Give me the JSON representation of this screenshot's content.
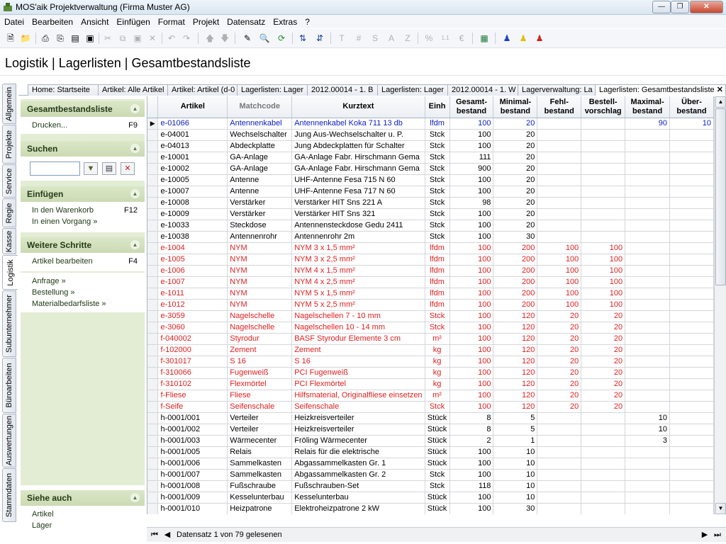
{
  "window": {
    "title": "MOS'aik Projektverwaltung (Firma Muster AG)"
  },
  "menu": [
    "Datei",
    "Bearbeiten",
    "Ansicht",
    "Einfügen",
    "Format",
    "Projekt",
    "Datensatz",
    "Extras",
    "?"
  ],
  "page_title": "Logistik | Lagerlisten | Gesamtbestandsliste",
  "vertical_tabs": [
    "Allgemein",
    "Projekte",
    "Service",
    "Regie",
    "Kasse",
    "Logistik",
    "Subunternehmer",
    "Büroarbeiten",
    "Auswertungen",
    "Stammdaten"
  ],
  "doc_tabs": [
    "Home: Startseite",
    "Artikel: Alle Artikel",
    "Artikel: Artikel (d-0",
    "Lagerlisten: Lager",
    "2012.00014 - 1. B",
    "Lagerlisten: Lager",
    "2012.00014 - 1. W",
    "Lagerverwaltung: La",
    "Lagerlisten: Gesamtbestandsliste"
  ],
  "sidebar": {
    "gesamt": {
      "title": "Gesamtbestandsliste",
      "print_label": "Drucken...",
      "print_key": "F9"
    },
    "suchen": {
      "title": "Suchen",
      "search_value": ""
    },
    "einfuegen": {
      "title": "Einfügen",
      "cart_label": "In den Warenkorb",
      "cart_key": "F12",
      "process_label": "In einen Vorgang »"
    },
    "weitere": {
      "title": "Weitere Schritte",
      "edit_label": "Artikel bearbeiten",
      "edit_key": "F4",
      "anfrage": "Anfrage »",
      "bestellung": "Bestellung »",
      "material": "Materialbedarfsliste »"
    },
    "siehe": {
      "title": "Siehe auch",
      "artikel": "Artikel",
      "lager": "Läger"
    }
  },
  "table": {
    "columns": [
      "Artikel",
      "Matchcode",
      "Kurztext",
      "Einh",
      "Gesamt-\nbestand",
      "Minimal-\nbestand",
      "Fehl-\nbestand",
      "Bestell-\nvorschlag",
      "Maximal-\nbestand",
      "Über-\nbestand"
    ],
    "rows": [
      {
        "c": [
          "e-01066",
          "Antennenkabel",
          "Antennenkabel Koka 711 13 db",
          "lfdm",
          "100",
          "20",
          "",
          "",
          "90",
          "10"
        ],
        "color": "blue",
        "current": true
      },
      {
        "c": [
          "e-04001",
          "Wechselschalter",
          "Jung Aus-Wechselschalter u. P.",
          "Stck",
          "100",
          "20",
          "",
          "",
          "",
          ""
        ]
      },
      {
        "c": [
          "e-04013",
          "Abdeckplatte",
          "Jung Abdeckplatten für Schalter",
          "Stck",
          "100",
          "20",
          "",
          "",
          "",
          ""
        ]
      },
      {
        "c": [
          "e-10001",
          "GA-Anlage",
          "GA-Anlage Fabr. Hirschmann Gema",
          "Stck",
          "111",
          "20",
          "",
          "",
          "",
          ""
        ]
      },
      {
        "c": [
          "e-10002",
          "GA-Anlage",
          "GA-Anlage Fabr. Hirschmann Gema",
          "Stck",
          "900",
          "20",
          "",
          "",
          "",
          ""
        ]
      },
      {
        "c": [
          "e-10005",
          "Antenne",
          "UHF-Antenne Fesa 715 N 60",
          "Stck",
          "100",
          "20",
          "",
          "",
          "",
          ""
        ]
      },
      {
        "c": [
          "e-10007",
          "Antenne",
          "UHF-Antenne Fesa 717 N 60",
          "Stck",
          "100",
          "20",
          "",
          "",
          "",
          ""
        ]
      },
      {
        "c": [
          "e-10008",
          "Verstärker",
          "Verstärker HIT Sns 221 A",
          "Stck",
          "98",
          "20",
          "",
          "",
          "",
          ""
        ]
      },
      {
        "c": [
          "e-10009",
          "Verstärker",
          "Verstärker HIT Sns 321",
          "Stck",
          "100",
          "20",
          "",
          "",
          "",
          ""
        ]
      },
      {
        "c": [
          "e-10033",
          "Steckdose",
          "Antennensteckdose Gedu 2411",
          "Stck",
          "100",
          "20",
          "",
          "",
          "",
          ""
        ]
      },
      {
        "c": [
          "e-10038",
          "Antennenrohr",
          "Antennenrohr 2m",
          "Stck",
          "100",
          "30",
          "",
          "",
          "",
          ""
        ]
      },
      {
        "c": [
          "e-1004",
          "NYM",
          "NYM 3 x 1,5 mm²",
          "lfdm",
          "100",
          "200",
          "100",
          "100",
          "",
          ""
        ],
        "color": "red"
      },
      {
        "c": [
          "e-1005",
          "NYM",
          "NYM 3 x 2,5 mm²",
          "lfdm",
          "100",
          "200",
          "100",
          "100",
          "",
          ""
        ],
        "color": "red"
      },
      {
        "c": [
          "e-1006",
          "NYM",
          "NYM 4 x 1,5 mm²",
          "lfdm",
          "100",
          "200",
          "100",
          "100",
          "",
          ""
        ],
        "color": "red"
      },
      {
        "c": [
          "e-1007",
          "NYM",
          "NYM 4 x 2,5 mm²",
          "lfdm",
          "100",
          "200",
          "100",
          "100",
          "",
          ""
        ],
        "color": "red"
      },
      {
        "c": [
          "e-1011",
          "NYM",
          "NYM 5 x 1,5 mm²",
          "lfdm",
          "100",
          "200",
          "100",
          "100",
          "",
          ""
        ],
        "color": "red"
      },
      {
        "c": [
          "e-1012",
          "NYM",
          "NYM 5 x 2,5 mm²",
          "lfdm",
          "100",
          "200",
          "100",
          "100",
          "",
          ""
        ],
        "color": "red"
      },
      {
        "c": [
          "e-3059",
          "Nagelschelle",
          "Nagelschellen 7 - 10 mm",
          "Stck",
          "100",
          "120",
          "20",
          "20",
          "",
          ""
        ],
        "color": "red"
      },
      {
        "c": [
          "e-3060",
          "Nagelschelle",
          "Nagelschellen 10 - 14 mm",
          "Stck",
          "100",
          "120",
          "20",
          "20",
          "",
          ""
        ],
        "color": "red"
      },
      {
        "c": [
          "f-040002",
          "Styrodur",
          "BASF Styrodur Elemente 3 cm",
          "m²",
          "100",
          "120",
          "20",
          "20",
          "",
          ""
        ],
        "color": "red"
      },
      {
        "c": [
          "f-102000",
          "Zement",
          "Zement",
          "kg",
          "100",
          "120",
          "20",
          "20",
          "",
          ""
        ],
        "color": "red"
      },
      {
        "c": [
          "f-301017",
          "S 16",
          "S 16",
          "kg",
          "100",
          "120",
          "20",
          "20",
          "",
          ""
        ],
        "color": "red"
      },
      {
        "c": [
          "f-310066",
          "Fugenweiß",
          "PCI Fugenweiß",
          "kg",
          "100",
          "120",
          "20",
          "20",
          "",
          ""
        ],
        "color": "red"
      },
      {
        "c": [
          "f-310102",
          "Flexmörtel",
          "PCI Flexmörtel",
          "kg",
          "100",
          "120",
          "20",
          "20",
          "",
          ""
        ],
        "color": "red"
      },
      {
        "c": [
          "f-Fliese",
          "Fliese",
          "Hilfsmaterial, Originalfliese einsetzen",
          "m²",
          "100",
          "120",
          "20",
          "20",
          "",
          ""
        ],
        "color": "red"
      },
      {
        "c": [
          "f-Seife",
          "Seifenschale",
          "Seifenschale",
          "Stck",
          "100",
          "120",
          "20",
          "20",
          "",
          ""
        ],
        "color": "red"
      },
      {
        "c": [
          "h-0001/001",
          "Verteiler",
          "Heizkreisverteiler",
          "Stück",
          "8",
          "5",
          "",
          "",
          "10",
          ""
        ]
      },
      {
        "c": [
          "h-0001/002",
          "Verteiler",
          "Heizkreisverteiler",
          "Stück",
          "8",
          "5",
          "",
          "",
          "10",
          ""
        ]
      },
      {
        "c": [
          "h-0001/003",
          "Wärmecenter",
          "Fröling Wärmecenter",
          "Stück",
          "2",
          "1",
          "",
          "",
          "3",
          ""
        ]
      },
      {
        "c": [
          "h-0001/005",
          "Relais",
          "Relais für die elektrische",
          "Stück",
          "100",
          "10",
          "",
          "",
          "",
          ""
        ]
      },
      {
        "c": [
          "h-0001/006",
          "Sammelkasten",
          "Abgassammelkasten Gr. 1",
          "Stück",
          "100",
          "10",
          "",
          "",
          "",
          ""
        ]
      },
      {
        "c": [
          "h-0001/007",
          "Sammelkasten",
          "Abgassammelkasten Gr. 2",
          "Stck",
          "100",
          "10",
          "",
          "",
          "",
          ""
        ]
      },
      {
        "c": [
          "h-0001/008",
          "Fußschraube",
          "Fußschrauben-Set",
          "Stck",
          "118",
          "10",
          "",
          "",
          "",
          ""
        ]
      },
      {
        "c": [
          "h-0001/009",
          "Kesselunterbau",
          "Kesselunterbau",
          "Stück",
          "100",
          "10",
          "",
          "",
          "",
          ""
        ]
      },
      {
        "c": [
          "h-0001/010",
          "Heizpatrone",
          "Elektroheizpatrone 2 kW",
          "Stück",
          "100",
          "30",
          "",
          "",
          "",
          ""
        ]
      }
    ]
  },
  "status": {
    "record_text": "Datensatz 1 von 79 gelesenen"
  },
  "colors": {
    "blue_row": "#1020c0",
    "red_row": "#e02020",
    "panel_green": "#e3edd4"
  }
}
